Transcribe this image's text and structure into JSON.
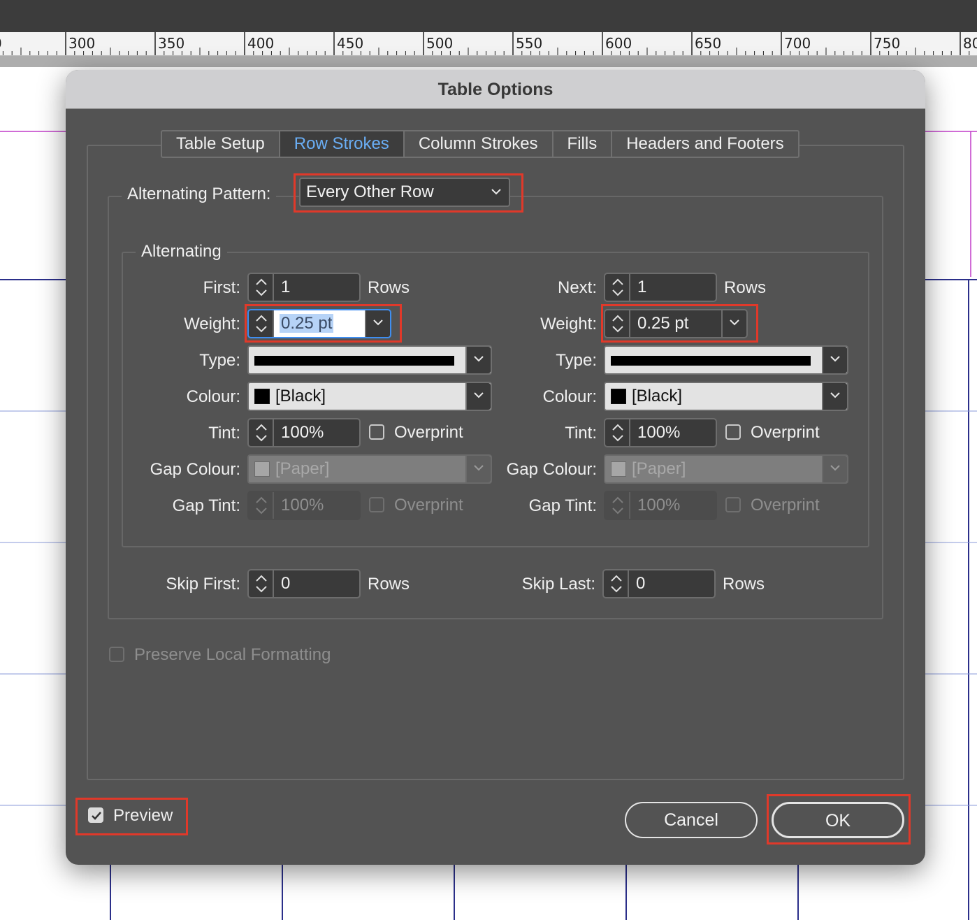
{
  "ruler": {
    "labels": [
      "0",
      "300",
      "350",
      "400",
      "450",
      "500",
      "550",
      "600",
      "650",
      "700",
      "750",
      "80"
    ]
  },
  "dialog": {
    "title": "Table Options",
    "tabs": [
      {
        "label": "Table Setup",
        "active": false
      },
      {
        "label": "Row Strokes",
        "active": true
      },
      {
        "label": "Column Strokes",
        "active": false
      },
      {
        "label": "Fills",
        "active": false
      },
      {
        "label": "Headers and Footers",
        "active": false
      }
    ],
    "alternating_pattern": {
      "label": "Alternating Pattern:",
      "value": "Every Other Row"
    },
    "alternating_group": {
      "title": "Alternating",
      "first": {
        "count_label": "First:",
        "count_value": "1",
        "count_unit": "Rows",
        "weight_label": "Weight:",
        "weight_value": "0.25 pt",
        "type_label": "Type:",
        "colour_label": "Colour:",
        "colour_value": "[Black]",
        "tint_label": "Tint:",
        "tint_value": "100%",
        "overprint_label": "Overprint",
        "gap_colour_label": "Gap Colour:",
        "gap_colour_value": "[Paper]",
        "gap_tint_label": "Gap Tint:",
        "gap_tint_value": "100%",
        "gap_overprint_label": "Overprint"
      },
      "next": {
        "count_label": "Next:",
        "count_value": "1",
        "count_unit": "Rows",
        "weight_label": "Weight:",
        "weight_value": "0.25 pt",
        "type_label": "Type:",
        "colour_label": "Colour:",
        "colour_value": "[Black]",
        "tint_label": "Tint:",
        "tint_value": "100%",
        "overprint_label": "Overprint",
        "gap_colour_label": "Gap Colour:",
        "gap_colour_value": "[Paper]",
        "gap_tint_label": "Gap Tint:",
        "gap_tint_value": "100%",
        "gap_overprint_label": "Overprint"
      }
    },
    "skip_first": {
      "label": "Skip First:",
      "value": "0",
      "unit": "Rows"
    },
    "skip_last": {
      "label": "Skip Last:",
      "value": "0",
      "unit": "Rows"
    },
    "preserve_local_formatting": {
      "label": "Preserve Local Formatting",
      "checked": false
    },
    "preview": {
      "label": "Preview",
      "checked": true
    },
    "buttons": {
      "cancel": "Cancel",
      "ok": "OK"
    },
    "colors": {
      "accent_tab": "#6aaef5",
      "highlight_box": "#e0392a",
      "dialog_bg": "#535353",
      "focus_ring": "#3f8ef0"
    }
  }
}
